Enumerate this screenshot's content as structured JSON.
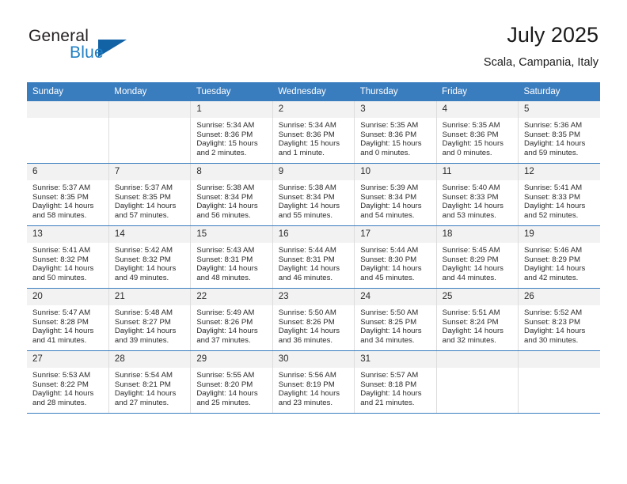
{
  "logo": {
    "word_top": "General",
    "word_bottom": "Blue",
    "triangle": "triangle-icon",
    "accent_color": "#1f7fc4"
  },
  "header": {
    "title": "July 2025",
    "subtitle": "Scala, Campania, Italy"
  },
  "theme": {
    "header_row_bg": "#3a7dbf",
    "daynum_bg": "#f2f2f2",
    "row_divider": "#3a7dbf",
    "cell_divider": "#dddddd"
  },
  "weekday_headers": [
    "Sunday",
    "Monday",
    "Tuesday",
    "Wednesday",
    "Thursday",
    "Friday",
    "Saturday"
  ],
  "weeks": [
    [
      {
        "day": "",
        "sunrise": "",
        "sunset": "",
        "daylight_1": "",
        "daylight_2": "",
        "empty": true
      },
      {
        "day": "",
        "sunrise": "",
        "sunset": "",
        "daylight_1": "",
        "daylight_2": "",
        "empty": true
      },
      {
        "day": "1",
        "sunrise": "Sunrise: 5:34 AM",
        "sunset": "Sunset: 8:36 PM",
        "daylight_1": "Daylight: 15 hours",
        "daylight_2": "and 2 minutes."
      },
      {
        "day": "2",
        "sunrise": "Sunrise: 5:34 AM",
        "sunset": "Sunset: 8:36 PM",
        "daylight_1": "Daylight: 15 hours",
        "daylight_2": "and 1 minute."
      },
      {
        "day": "3",
        "sunrise": "Sunrise: 5:35 AM",
        "sunset": "Sunset: 8:36 PM",
        "daylight_1": "Daylight: 15 hours",
        "daylight_2": "and 0 minutes."
      },
      {
        "day": "4",
        "sunrise": "Sunrise: 5:35 AM",
        "sunset": "Sunset: 8:36 PM",
        "daylight_1": "Daylight: 15 hours",
        "daylight_2": "and 0 minutes."
      },
      {
        "day": "5",
        "sunrise": "Sunrise: 5:36 AM",
        "sunset": "Sunset: 8:35 PM",
        "daylight_1": "Daylight: 14 hours",
        "daylight_2": "and 59 minutes."
      }
    ],
    [
      {
        "day": "6",
        "sunrise": "Sunrise: 5:37 AM",
        "sunset": "Sunset: 8:35 PM",
        "daylight_1": "Daylight: 14 hours",
        "daylight_2": "and 58 minutes."
      },
      {
        "day": "7",
        "sunrise": "Sunrise: 5:37 AM",
        "sunset": "Sunset: 8:35 PM",
        "daylight_1": "Daylight: 14 hours",
        "daylight_2": "and 57 minutes."
      },
      {
        "day": "8",
        "sunrise": "Sunrise: 5:38 AM",
        "sunset": "Sunset: 8:34 PM",
        "daylight_1": "Daylight: 14 hours",
        "daylight_2": "and 56 minutes."
      },
      {
        "day": "9",
        "sunrise": "Sunrise: 5:38 AM",
        "sunset": "Sunset: 8:34 PM",
        "daylight_1": "Daylight: 14 hours",
        "daylight_2": "and 55 minutes."
      },
      {
        "day": "10",
        "sunrise": "Sunrise: 5:39 AM",
        "sunset": "Sunset: 8:34 PM",
        "daylight_1": "Daylight: 14 hours",
        "daylight_2": "and 54 minutes."
      },
      {
        "day": "11",
        "sunrise": "Sunrise: 5:40 AM",
        "sunset": "Sunset: 8:33 PM",
        "daylight_1": "Daylight: 14 hours",
        "daylight_2": "and 53 minutes."
      },
      {
        "day": "12",
        "sunrise": "Sunrise: 5:41 AM",
        "sunset": "Sunset: 8:33 PM",
        "daylight_1": "Daylight: 14 hours",
        "daylight_2": "and 52 minutes."
      }
    ],
    [
      {
        "day": "13",
        "sunrise": "Sunrise: 5:41 AM",
        "sunset": "Sunset: 8:32 PM",
        "daylight_1": "Daylight: 14 hours",
        "daylight_2": "and 50 minutes."
      },
      {
        "day": "14",
        "sunrise": "Sunrise: 5:42 AM",
        "sunset": "Sunset: 8:32 PM",
        "daylight_1": "Daylight: 14 hours",
        "daylight_2": "and 49 minutes."
      },
      {
        "day": "15",
        "sunrise": "Sunrise: 5:43 AM",
        "sunset": "Sunset: 8:31 PM",
        "daylight_1": "Daylight: 14 hours",
        "daylight_2": "and 48 minutes."
      },
      {
        "day": "16",
        "sunrise": "Sunrise: 5:44 AM",
        "sunset": "Sunset: 8:31 PM",
        "daylight_1": "Daylight: 14 hours",
        "daylight_2": "and 46 minutes."
      },
      {
        "day": "17",
        "sunrise": "Sunrise: 5:44 AM",
        "sunset": "Sunset: 8:30 PM",
        "daylight_1": "Daylight: 14 hours",
        "daylight_2": "and 45 minutes."
      },
      {
        "day": "18",
        "sunrise": "Sunrise: 5:45 AM",
        "sunset": "Sunset: 8:29 PM",
        "daylight_1": "Daylight: 14 hours",
        "daylight_2": "and 44 minutes."
      },
      {
        "day": "19",
        "sunrise": "Sunrise: 5:46 AM",
        "sunset": "Sunset: 8:29 PM",
        "daylight_1": "Daylight: 14 hours",
        "daylight_2": "and 42 minutes."
      }
    ],
    [
      {
        "day": "20",
        "sunrise": "Sunrise: 5:47 AM",
        "sunset": "Sunset: 8:28 PM",
        "daylight_1": "Daylight: 14 hours",
        "daylight_2": "and 41 minutes."
      },
      {
        "day": "21",
        "sunrise": "Sunrise: 5:48 AM",
        "sunset": "Sunset: 8:27 PM",
        "daylight_1": "Daylight: 14 hours",
        "daylight_2": "and 39 minutes."
      },
      {
        "day": "22",
        "sunrise": "Sunrise: 5:49 AM",
        "sunset": "Sunset: 8:26 PM",
        "daylight_1": "Daylight: 14 hours",
        "daylight_2": "and 37 minutes."
      },
      {
        "day": "23",
        "sunrise": "Sunrise: 5:50 AM",
        "sunset": "Sunset: 8:26 PM",
        "daylight_1": "Daylight: 14 hours",
        "daylight_2": "and 36 minutes."
      },
      {
        "day": "24",
        "sunrise": "Sunrise: 5:50 AM",
        "sunset": "Sunset: 8:25 PM",
        "daylight_1": "Daylight: 14 hours",
        "daylight_2": "and 34 minutes."
      },
      {
        "day": "25",
        "sunrise": "Sunrise: 5:51 AM",
        "sunset": "Sunset: 8:24 PM",
        "daylight_1": "Daylight: 14 hours",
        "daylight_2": "and 32 minutes."
      },
      {
        "day": "26",
        "sunrise": "Sunrise: 5:52 AM",
        "sunset": "Sunset: 8:23 PM",
        "daylight_1": "Daylight: 14 hours",
        "daylight_2": "and 30 minutes."
      }
    ],
    [
      {
        "day": "27",
        "sunrise": "Sunrise: 5:53 AM",
        "sunset": "Sunset: 8:22 PM",
        "daylight_1": "Daylight: 14 hours",
        "daylight_2": "and 28 minutes."
      },
      {
        "day": "28",
        "sunrise": "Sunrise: 5:54 AM",
        "sunset": "Sunset: 8:21 PM",
        "daylight_1": "Daylight: 14 hours",
        "daylight_2": "and 27 minutes."
      },
      {
        "day": "29",
        "sunrise": "Sunrise: 5:55 AM",
        "sunset": "Sunset: 8:20 PM",
        "daylight_1": "Daylight: 14 hours",
        "daylight_2": "and 25 minutes."
      },
      {
        "day": "30",
        "sunrise": "Sunrise: 5:56 AM",
        "sunset": "Sunset: 8:19 PM",
        "daylight_1": "Daylight: 14 hours",
        "daylight_2": "and 23 minutes."
      },
      {
        "day": "31",
        "sunrise": "Sunrise: 5:57 AM",
        "sunset": "Sunset: 8:18 PM",
        "daylight_1": "Daylight: 14 hours",
        "daylight_2": "and 21 minutes."
      },
      {
        "day": "",
        "sunrise": "",
        "sunset": "",
        "daylight_1": "",
        "daylight_2": "",
        "empty": true
      },
      {
        "day": "",
        "sunrise": "",
        "sunset": "",
        "daylight_1": "",
        "daylight_2": "",
        "empty": true
      }
    ]
  ]
}
